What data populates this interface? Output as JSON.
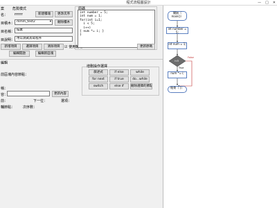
{
  "window": {
    "title": "程式流程圖設計",
    "minimize": "—",
    "maximize": "□",
    "close": "✕"
  },
  "editor": {
    "tab_left": "案",
    "tab_mode": "危險模式",
    "name_label": "名：",
    "name_value": "rrrrrr",
    "btn_new_block": "新建積塊",
    "btn_change_order": "更改次序",
    "block_label": "目積木：",
    "block_value": "mmm_test2",
    "btn_delete_block": "刪除積木",
    "desc_label": "目名稱：",
    "desc_value": "描素",
    "note_label": "目說明：",
    "note_value": "用以測試及寫程序",
    "btn_new_item": "新增項目",
    "btn_select_item": "選擇項目",
    "btn_clear_item": "清除項目",
    "check_show_label": "使用輔助",
    "btn_edit_open": "編輯開啟",
    "btn_edit_new": "編輯新區塊"
  },
  "code": {
    "title": "原碼",
    "lines": [
      "int number = 5;",
      "int num = 1;",
      "for(int i=1;",
      "  i < 5;",
      "  i++)",
      "{ num *= i; }",
      "}"
    ],
    "btn_update": "更新原碼"
  },
  "lower": {
    "section_title": "編輯",
    "section_sub": "前區塊內容節點：",
    "palette_title": "增刪操作選擇",
    "palette": [
      [
        "敘述式",
        "if else",
        "while"
      ],
      [
        "for next",
        "if true",
        "do...while"
      ],
      [
        "switch",
        "else if",
        "刪除選擇的節點"
      ]
    ],
    "field1_label": "稱：",
    "field2_label": "容：",
    "btn_update_content": "更新內容",
    "prev_label": "前：",
    "next_label": "下一位：",
    "select_label": "選項：",
    "id_label": "輔節點：",
    "seq_label": "次序數："
  },
  "flow": {
    "start": "開始（\nmain()）",
    "n1": "int number = 5;",
    "n2": "int num = 1;",
    "decision": "i<5",
    "false_label": "False",
    "true_label": "True",
    "n3": "num *= i;",
    "end": "結束（ }）"
  }
}
